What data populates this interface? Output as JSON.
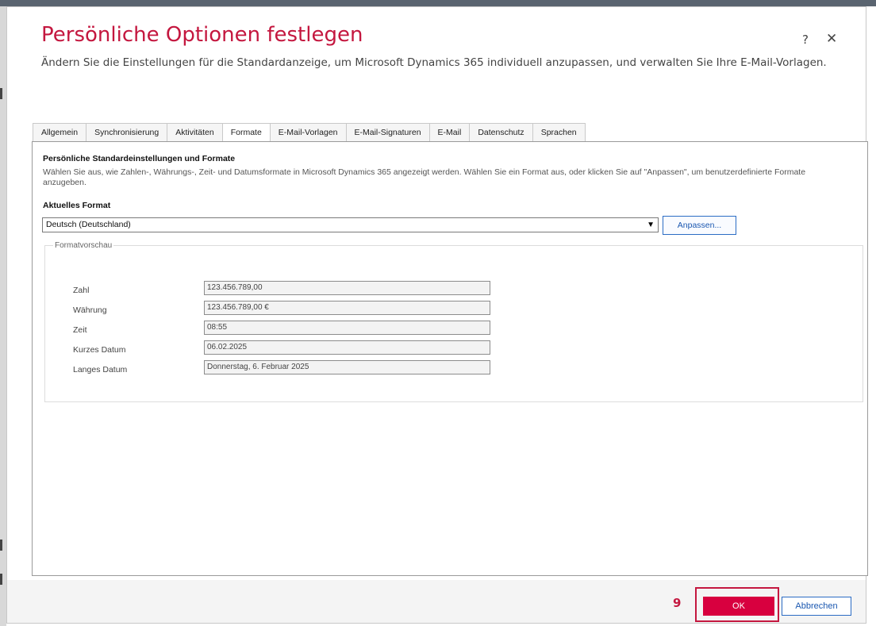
{
  "dialog": {
    "title": "Persönliche Optionen festlegen",
    "subtitle": "Ändern Sie die Einstellungen für die Standardanzeige, um Microsoft Dynamics 365 individuell anzupassen, und verwalten Sie Ihre E-Mail-Vorlagen.",
    "help_label": "?",
    "close_label": "✕"
  },
  "tabs": [
    {
      "label": "Allgemein"
    },
    {
      "label": "Synchronisierung"
    },
    {
      "label": "Aktivitäten"
    },
    {
      "label": "Formate",
      "active": true
    },
    {
      "label": "E-Mail-Vorlagen"
    },
    {
      "label": "E-Mail-Signaturen"
    },
    {
      "label": "E-Mail"
    },
    {
      "label": "Datenschutz"
    },
    {
      "label": "Sprachen"
    }
  ],
  "formats": {
    "section_title": "Persönliche Standardeinstellungen und Formate",
    "description": "Wählen Sie aus, wie Zahlen-, Währungs-, Zeit- und Datumsformate in Microsoft Dynamics 365 angezeigt werden. Wählen Sie ein Format aus, oder klicken Sie auf \"Anpassen\", um benutzerdefinierte Formate anzugeben.",
    "current_format_label": "Aktuelles Format",
    "current_format_value": "Deutsch (Deutschland)",
    "customize_label": "Anpassen...",
    "preview_legend": "Formatvorschau",
    "preview": [
      {
        "label": "Zahl",
        "value": "123.456.789,00"
      },
      {
        "label": "Währung",
        "value": "123.456.789,00 €"
      },
      {
        "label": "Zeit",
        "value": "08:55"
      },
      {
        "label": "Kurzes Datum",
        "value": "06.02.2025"
      },
      {
        "label": "Langes Datum",
        "value": "Donnerstag, 6. Februar 2025"
      }
    ]
  },
  "footer": {
    "step_number": "9",
    "ok_label": "OK",
    "cancel_label": "Abbrechen"
  },
  "colors": {
    "accent": "#c4173f",
    "ok_button": "#d8003f",
    "link_blue": "#1a57b0"
  }
}
